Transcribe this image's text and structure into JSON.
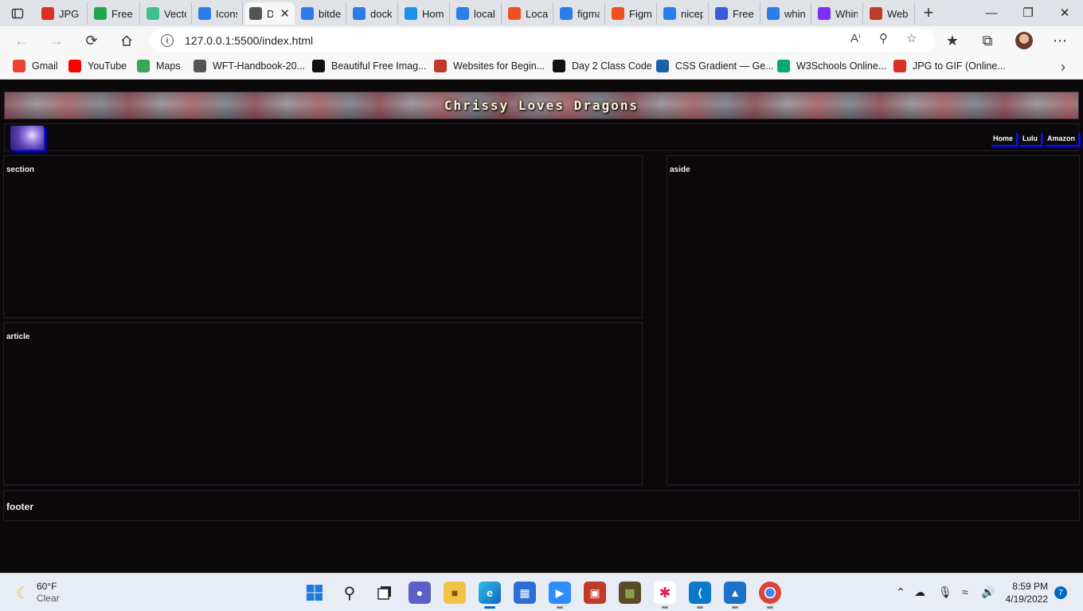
{
  "browser": {
    "tabs": [
      {
        "title": "JPG t",
        "icon": "jpg-gif-icon",
        "color": "#d93025"
      },
      {
        "title": "Free",
        "icon": "freepik-icon",
        "color": "#1fa54a"
      },
      {
        "title": "Vecto",
        "icon": "vectorizer-icon",
        "color": "#3fbf8f"
      },
      {
        "title": "Icons",
        "icon": "heart-icon",
        "color": "#2b7de9"
      },
      {
        "title": "D",
        "icon": "page-icon",
        "color": "#555555"
      },
      {
        "title": "bitde",
        "icon": "bing-icon",
        "color": "#2b7de9"
      },
      {
        "title": "dock",
        "icon": "bing-icon",
        "color": "#2b7de9"
      },
      {
        "title": "Hom",
        "icon": "docker-icon",
        "color": "#1d91e6"
      },
      {
        "title": "local",
        "icon": "bing-icon",
        "color": "#2b7de9"
      },
      {
        "title": "Local",
        "icon": "microsoft-icon",
        "color": "#f25022"
      },
      {
        "title": "figma",
        "icon": "bing-icon",
        "color": "#2b7de9"
      },
      {
        "title": "Figm",
        "icon": "figma-icon",
        "color": "#f24e1e"
      },
      {
        "title": "nicep",
        "icon": "bing-icon",
        "color": "#2b7de9"
      },
      {
        "title": "Free",
        "icon": "n-icon",
        "color": "#3b5bdb"
      },
      {
        "title": "whin",
        "icon": "bing-icon",
        "color": "#2b7de9"
      },
      {
        "title": "Whin",
        "icon": "whimsical-icon",
        "color": "#7b2ff7"
      },
      {
        "title": "Web",
        "icon": "w3-icon",
        "color": "#c0392b"
      }
    ],
    "active_tab_index": 4,
    "url": "127.0.0.1:5500/index.html",
    "bookmarks": [
      {
        "label": "Gmail",
        "icon": "gmail-icon",
        "color": "#ea4335"
      },
      {
        "label": "YouTube",
        "icon": "youtube-icon",
        "color": "#ff0000"
      },
      {
        "label": "Maps",
        "icon": "maps-icon",
        "color": "#34a853"
      },
      {
        "label": "WFT-Handbook-20...",
        "icon": "page-icon",
        "color": "#555555"
      },
      {
        "label": "Beautiful Free Imag...",
        "icon": "unsplash-icon",
        "color": "#111111"
      },
      {
        "label": "Websites for Begin...",
        "icon": "w-icon",
        "color": "#c0392b"
      },
      {
        "label": "Day 2 Class Code",
        "icon": "codepen-icon",
        "color": "#111111"
      },
      {
        "label": "CSS Gradient — Ge...",
        "icon": "gradient-icon",
        "color": "#1e5fa8"
      },
      {
        "label": "W3Schools Online...",
        "icon": "w3schools-icon",
        "color": "#04aa6d"
      },
      {
        "label": "JPG to GIF (Online...",
        "icon": "jpg-gif-icon",
        "color": "#d93025"
      }
    ]
  },
  "site": {
    "title": "Chrissy Loves Dragons",
    "nav": [
      "Home",
      "Lulu",
      "Amazon"
    ],
    "section_label": "section",
    "article_label": "article",
    "aside_label": "aside",
    "footer_label": "footer"
  },
  "taskbar": {
    "weather_temp": "60°F",
    "weather_cond": "Clear",
    "time": "8:59 PM",
    "date": "4/19/2022",
    "notifications": "7"
  }
}
